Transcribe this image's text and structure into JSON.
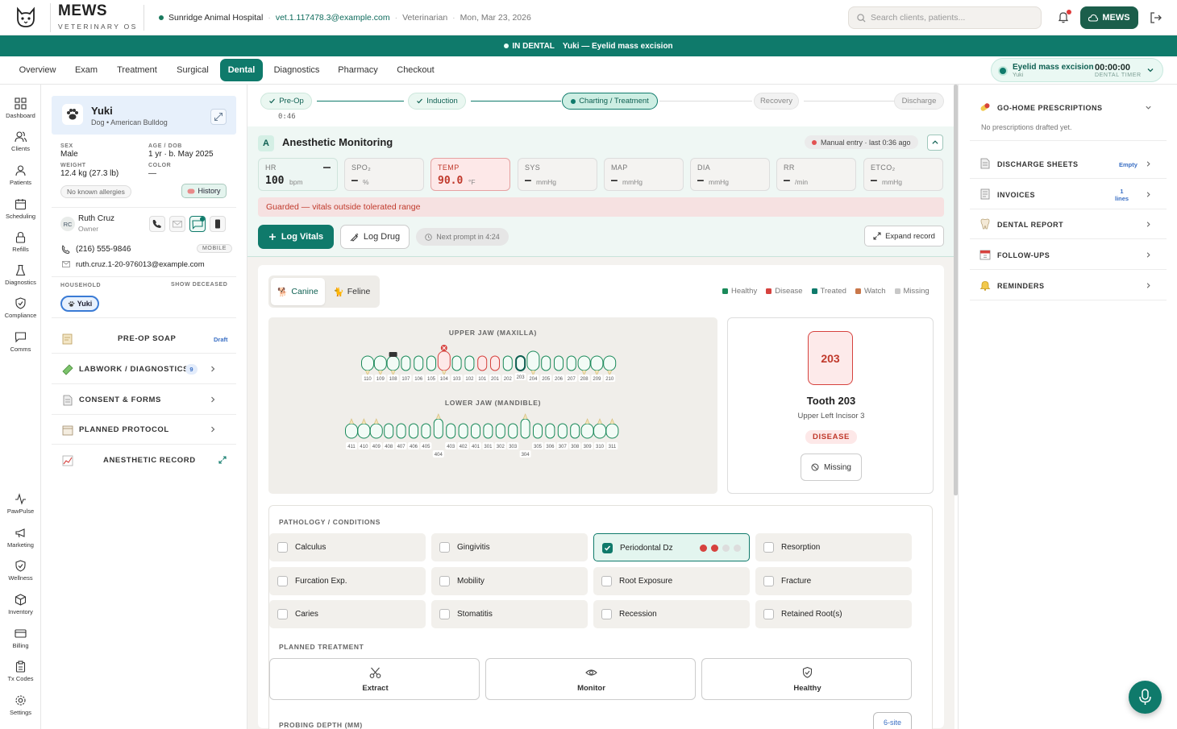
{
  "brand": {
    "name": "MEWS",
    "sub": "VETERINARY OS"
  },
  "context": {
    "hospital": "Sunridge Animal Hospital",
    "user": "vet.1.117478.3@example.com",
    "role": "Veterinarian",
    "date": "Mon, Mar 23, 2026"
  },
  "search": {
    "placeholder": "Search clients, patients..."
  },
  "mews_button": "MEWS",
  "banner": {
    "status": "IN DENTAL",
    "text": "Yuki — Eyelid mass excision"
  },
  "tabs": [
    "Overview",
    "Exam",
    "Treatment",
    "Surgical",
    "Dental",
    "Diagnostics",
    "Pharmacy",
    "Checkout"
  ],
  "active_tab": "Dental",
  "timer": {
    "procedure": "Eyelid mass excision",
    "patient": "Yuki",
    "time": "00:00:00",
    "label": "DENTAL TIMER"
  },
  "nav_top": [
    "Dashboard",
    "Clients",
    "Patients",
    "Scheduling",
    "Refills",
    "Diagnostics",
    "Compliance",
    "Comms"
  ],
  "nav_bottom": [
    "PawPulse",
    "Marketing",
    "Wellness",
    "Inventory",
    "Billing",
    "Tx Codes",
    "Settings"
  ],
  "patient": {
    "name": "Yuki",
    "breed": "Dog • American Bulldog",
    "sex_label": "SEX",
    "sex": "Male",
    "age_label": "AGE / DOB",
    "age": "1 yr · b. May 2025",
    "weight_label": "WEIGHT",
    "weight": "12.4 kg (27.3 lb)",
    "color_label": "COLOR",
    "color": "—",
    "allergies": "No known allergies",
    "history": "History"
  },
  "owner": {
    "initials": "RC",
    "name": "Ruth Cruz",
    "role": "Owner",
    "phone": "(216) 555-9846",
    "phone_type": "MOBILE",
    "email": "ruth.cruz.1-20-976013@example.com"
  },
  "household": {
    "label": "HOUSEHOLD",
    "show_deceased": "SHOW DECEASED",
    "member": "Yuki"
  },
  "sections": [
    {
      "title": "PRE-OP SOAP",
      "badge": "Draft"
    },
    {
      "title": "LABWORK / DIAGNOSTICS",
      "badge": "9"
    },
    {
      "title": "CONSENT & FORMS",
      "badge": ""
    },
    {
      "title": "PLANNED PROTOCOL",
      "badge": ""
    },
    {
      "title": "ANESTHETIC RECORD",
      "badge": ""
    }
  ],
  "stepper": {
    "steps": [
      {
        "label": "Pre-Op",
        "state": "done"
      },
      {
        "label": "Induction",
        "state": "done"
      },
      {
        "label": "Charting / Treatment",
        "state": "current"
      },
      {
        "label": "Recovery",
        "state": "future"
      },
      {
        "label": "Discharge",
        "state": "future"
      }
    ],
    "elapsed": "0:46"
  },
  "anesthetic": {
    "badge": "A",
    "title": "Anesthetic Monitoring",
    "entry_status": "Manual entry · last 0:36 ago",
    "vitals": [
      {
        "key": "HR",
        "value": "100",
        "unit": "bpm"
      },
      {
        "key": "SPO₂",
        "value": "—",
        "unit": "%"
      },
      {
        "key": "TEMP",
        "value": "90.0",
        "unit": "°F"
      },
      {
        "key": "SYS",
        "value": "—",
        "unit": "mmHg"
      },
      {
        "key": "MAP",
        "value": "—",
        "unit": "mmHg"
      },
      {
        "key": "DIA",
        "value": "—",
        "unit": "mmHg"
      },
      {
        "key": "RR",
        "value": "—",
        "unit": "/min"
      },
      {
        "key": "ETCO₂",
        "value": "—",
        "unit": "mmHg"
      }
    ],
    "alert": "Guarded — vitals outside tolerated range",
    "log_vitals": "Log Vitals",
    "log_drug": "Log Drug",
    "next_prompt": "Next prompt in 4:24",
    "expand_record": "Expand record"
  },
  "species": [
    "Canine",
    "Feline"
  ],
  "legend": [
    {
      "label": "Healthy",
      "color": "#1a8a5a"
    },
    {
      "label": "Disease",
      "color": "#d6423e"
    },
    {
      "label": "Treated",
      "color": "#0f7a6b"
    },
    {
      "label": "Watch",
      "color": "#c9774a"
    },
    {
      "label": "Missing",
      "color": "#c8c8c8"
    }
  ],
  "jaws": {
    "upper_label": "UPPER JAW (MAXILLA)",
    "lower_label": "LOWER JAW (MANDIBLE)",
    "upper": [
      "110",
      "109",
      "108",
      "107",
      "106",
      "105",
      "104",
      "103",
      "102",
      "101",
      "201",
      "202",
      "203",
      "204",
      "205",
      "206",
      "207",
      "208",
      "209",
      "210"
    ],
    "lower": [
      "411",
      "410",
      "409",
      "408",
      "407",
      "406",
      "405",
      "404",
      "403",
      "402",
      "401",
      "301",
      "302",
      "303",
      "304",
      "305",
      "306",
      "307",
      "308",
      "309",
      "310",
      "311"
    ],
    "upper_disease": [
      "104",
      "101",
      "201"
    ],
    "upper_selected": "203"
  },
  "tooth": {
    "number": "203",
    "title": "Tooth 203",
    "subtitle": "Upper Left Incisor 3",
    "status": "DISEASE",
    "missing_button": "Missing"
  },
  "pathology": {
    "label": "PATHOLOGY / CONDITIONS",
    "items": [
      "Calculus",
      "Gingivitis",
      "Periodontal Dz",
      "Resorption",
      "Furcation Exp.",
      "Mobility",
      "Root Exposure",
      "Fracture",
      "Caries",
      "Stomatitis",
      "Recession",
      "Retained Root(s)"
    ],
    "checked": "Periodontal Dz",
    "severity": 2
  },
  "planned": {
    "label": "PLANNED TREATMENT",
    "items": [
      "Extract",
      "Monitor",
      "Healthy"
    ]
  },
  "probing": {
    "label": "PROBING DEPTH (MM)",
    "button": "6-site"
  },
  "right_panel": {
    "prescriptions": {
      "title": "GO-HOME PRESCRIPTIONS",
      "empty": "No prescriptions drafted yet."
    },
    "items": [
      {
        "title": "DISCHARGE SHEETS",
        "badge": "Empty"
      },
      {
        "title": "INVOICES",
        "badge": "1 lines"
      },
      {
        "title": "DENTAL REPORT",
        "badge": ""
      },
      {
        "title": "FOLLOW-UPS",
        "badge": ""
      },
      {
        "title": "REMINDERS",
        "badge": ""
      }
    ]
  }
}
